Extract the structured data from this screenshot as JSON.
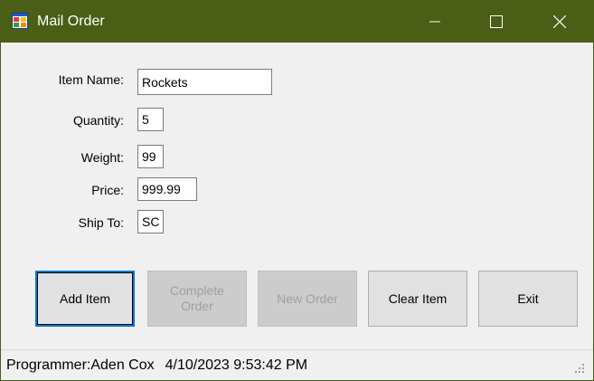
{
  "window": {
    "title": "Mail Order",
    "icon": "form-app-icon",
    "title_bar_color": "#4a5e16",
    "controls": [
      "minimize-icon",
      "maximize-icon",
      "close-icon"
    ]
  },
  "form": {
    "item_name": {
      "label": "Item Name:",
      "value": "Rockets"
    },
    "quantity": {
      "label": "Quantity:",
      "value": "5"
    },
    "weight": {
      "label": "Weight:",
      "value": "99"
    },
    "price": {
      "label": "Price:",
      "value": "999.99"
    },
    "ship_to": {
      "label": "Ship To:",
      "value": "SC"
    }
  },
  "buttons": {
    "add_item": {
      "label": "Add Item",
      "enabled": true,
      "focused": true
    },
    "complete_order": {
      "label": "Complete Order",
      "enabled": false
    },
    "new_order": {
      "label": "New Order",
      "enabled": false
    },
    "clear_item": {
      "label": "Clear Item",
      "enabled": true
    },
    "exit": {
      "label": "Exit",
      "enabled": true
    }
  },
  "status_bar": {
    "programmer": "Programmer:Aden Cox",
    "timestamp": "4/10/2023 9:53:42 PM"
  },
  "colors": {
    "accent_focus": "#0078d7",
    "background": "#f0f0f0"
  }
}
